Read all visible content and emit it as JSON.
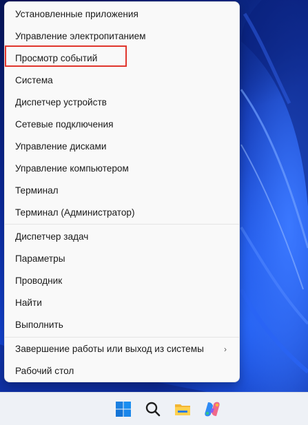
{
  "menu": {
    "items": [
      {
        "label": "Установленные приложения"
      },
      {
        "label": "Управление электропитанием"
      },
      {
        "label": "Просмотр событий"
      },
      {
        "label": "Система"
      },
      {
        "label": "Диспетчер устройств"
      },
      {
        "label": "Сетевые подключения"
      },
      {
        "label": "Управление дисками"
      },
      {
        "label": "Управление компьютером"
      },
      {
        "label": "Терминал"
      },
      {
        "label": "Терминал (Администратор)"
      },
      {
        "label": "Диспетчер задач"
      },
      {
        "label": "Параметры"
      },
      {
        "label": "Проводник"
      },
      {
        "label": "Найти"
      },
      {
        "label": "Выполнить"
      },
      {
        "label": "Завершение работы или выход из системы"
      },
      {
        "label": "Рабочий стол"
      }
    ],
    "submenu_arrow": "›",
    "highlighted_item": "Просмотр событий",
    "highlight_color": "#e0352c"
  },
  "taskbar": {
    "icons": [
      "windows-start-icon",
      "search-icon",
      "file-explorer-icon",
      "copilot-icon"
    ]
  }
}
